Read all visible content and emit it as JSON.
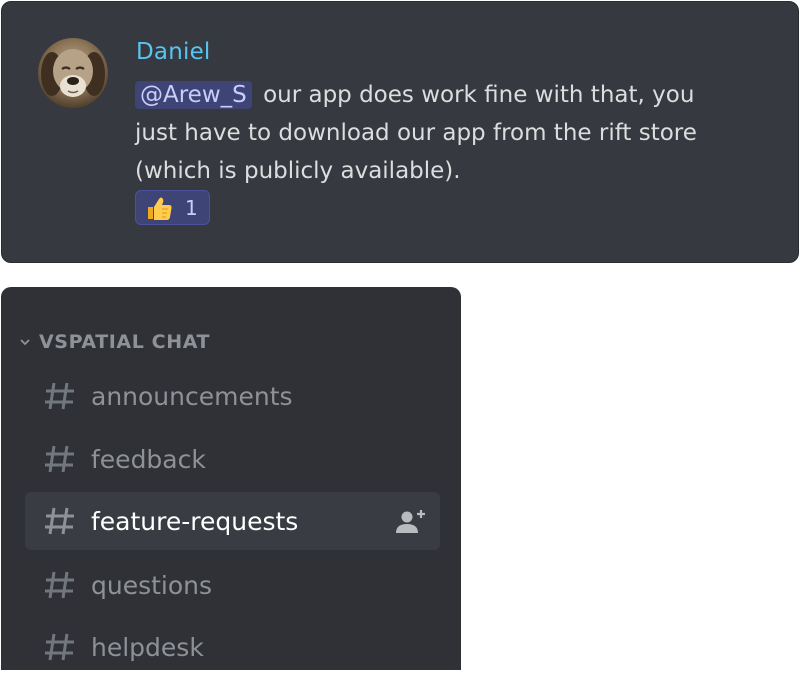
{
  "message": {
    "author": "Daniel",
    "mention": "@Arew_S",
    "text": "our app does work fine with that, you just have to download our app from the rift store (which is publicly available).",
    "reaction": {
      "emoji": "thumbs-up",
      "count": "1"
    }
  },
  "sidebar": {
    "category": "VSPATIAL CHAT",
    "channels": [
      {
        "name": "announcements",
        "selected": false
      },
      {
        "name": "feedback",
        "selected": false
      },
      {
        "name": "feature-requests",
        "selected": true
      },
      {
        "name": "questions",
        "selected": false
      },
      {
        "name": "helpdesk",
        "selected": false
      }
    ]
  },
  "colors": {
    "author": "#59c4f0",
    "mention_bg": "#3f4476",
    "background": "#36393f",
    "sidebar_bg": "#2f3136",
    "selected_channel_bg": "#393c43"
  }
}
